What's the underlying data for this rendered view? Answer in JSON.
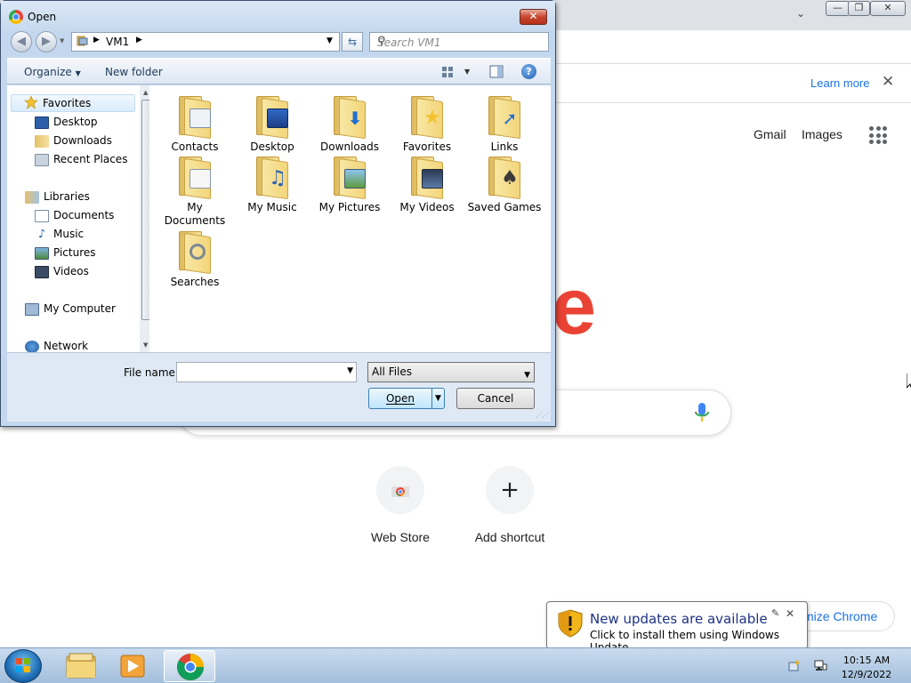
{
  "browser": {
    "infobar": {
      "learn_more": "Learn more",
      "close": "✕"
    },
    "top_links": {
      "gmail": "Gmail",
      "images": "Images"
    },
    "logo_fragment": "e",
    "shortcuts": [
      {
        "label": "Web Store"
      },
      {
        "label": "Add shortcut",
        "icon": "+"
      }
    ],
    "customize_label": "mize Chrome",
    "window_controls": {
      "minimize": "—",
      "restore": "❐",
      "close": "✕"
    }
  },
  "dialog": {
    "title": "Open",
    "address": {
      "crumb": "VM1"
    },
    "search_placeholder": "Search VM1",
    "toolbar": {
      "organize": "Organize",
      "new_folder": "New folder"
    },
    "nav": {
      "favorites_header": "Favorites",
      "favorites": [
        "Desktop",
        "Downloads",
        "Recent Places"
      ],
      "libraries_header": "Libraries",
      "libraries": [
        "Documents",
        "Music",
        "Pictures",
        "Videos"
      ],
      "computer": "My Computer",
      "network": "Network"
    },
    "items": [
      {
        "label": "Contacts",
        "icon": "contacts-folder-icon"
      },
      {
        "label": "Desktop",
        "icon": "desktop-folder-icon"
      },
      {
        "label": "Downloads",
        "icon": "downloads-folder-icon"
      },
      {
        "label": "Favorites",
        "icon": "favorites-folder-icon"
      },
      {
        "label": "Links",
        "icon": "links-folder-icon"
      },
      {
        "label": "My Documents",
        "icon": "documents-folder-icon"
      },
      {
        "label": "My Music",
        "icon": "music-folder-icon"
      },
      {
        "label": "My Pictures",
        "icon": "pictures-folder-icon"
      },
      {
        "label": "My Videos",
        "icon": "videos-folder-icon"
      },
      {
        "label": "Saved Games",
        "icon": "games-folder-icon"
      },
      {
        "label": "Searches",
        "icon": "searches-folder-icon"
      }
    ],
    "file_name_label": "File name:",
    "file_name_value": "",
    "filter": "All Files",
    "open_button": "Open",
    "cancel_button": "Cancel"
  },
  "notification": {
    "title": "New updates are available",
    "body": "Click to install them using Windows Update."
  },
  "taskbar": {
    "time": "10:15 AM",
    "date": "12/9/2022"
  }
}
